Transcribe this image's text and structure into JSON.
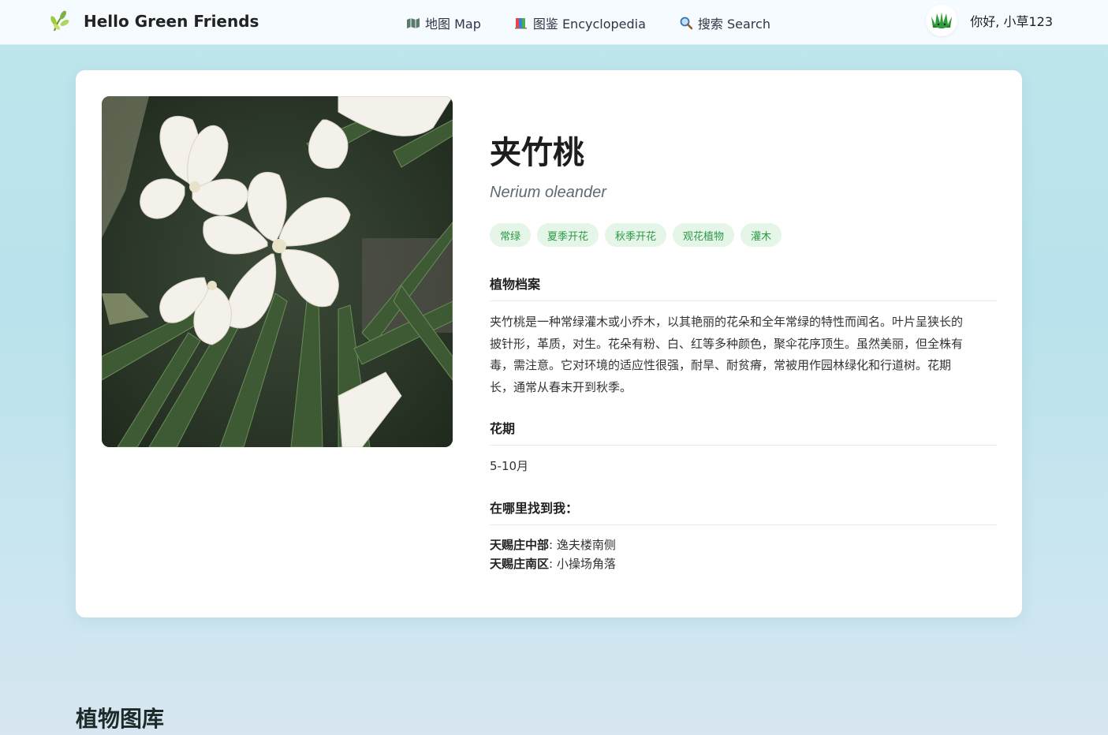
{
  "header": {
    "brand_title": "Hello Green Friends",
    "logo_icon": "sprout-icon",
    "nav": [
      {
        "label": "地图 Map",
        "icon": "map-icon"
      },
      {
        "label": "图鉴 Encyclopedia",
        "icon": "books-icon"
      },
      {
        "label": "搜索 Search",
        "icon": "magnifier-icon"
      }
    ],
    "user": {
      "greeting": "你好, 小草123",
      "avatar_icon": "grass-avatar-icon"
    }
  },
  "plant": {
    "name": "夹竹桃",
    "latin": "Nerium oleander",
    "tags": [
      "常绿",
      "夏季开花",
      "秋季开花",
      "观花植物",
      "灌木"
    ],
    "profile_title": "植物档案",
    "description_lines": [
      "夹竹桃是一种常绿灌木或小乔木，以其艳丽的花朵和全年常绿的特性而闻名。叶片呈狭长的",
      "披针形，革质，对生。花朵有粉、白、红等多种颜色，聚伞花序顶生。虽然美丽，但全株有",
      "毒，需注意。它对环境的适应性很强，耐旱、耐贫瘠，常被用作园林绿化和行道树。花期",
      "长，通常从春末开到秋季。"
    ],
    "bloom_title": "花期",
    "bloom_value": "5-10月",
    "location_title": "在哪里找到我：",
    "locations": [
      {
        "area": "天赐庄中部",
        "spot": ": 逸夫楼南侧"
      },
      {
        "area": "天赐庄南区",
        "spot": ": 小操场角落"
      }
    ]
  },
  "gallery": {
    "title": "植物图库"
  },
  "colors": {
    "tag_bg": "#e5f5e8",
    "tag_text": "#2a9a45",
    "accent": "#2a9a45"
  }
}
